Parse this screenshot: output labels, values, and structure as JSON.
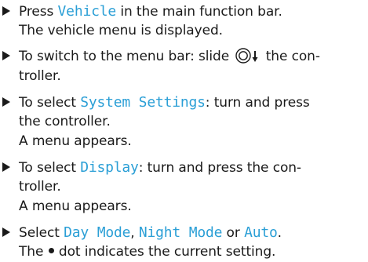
{
  "steps": [
    {
      "lines": [
        {
          "before": "Press ",
          "keyword": "Vehicle",
          "after": " in the main function bar."
        },
        {
          "text": "The vehicle menu is displayed."
        }
      ]
    },
    {
      "lines": [
        {
          "before": "To switch to the menu bar: slide ",
          "icon": "controller-slide-down-icon",
          "after": " the con-"
        },
        {
          "text": "troller."
        }
      ]
    },
    {
      "lines": [
        {
          "before": "To select ",
          "keyword": "System Settings",
          "after": ": turn and press"
        },
        {
          "text": "the controller."
        },
        {
          "text": "A menu appears."
        }
      ]
    },
    {
      "lines": [
        {
          "before": "To select ",
          "keyword": "Display",
          "after": ": turn and press the con-"
        },
        {
          "text": "troller."
        },
        {
          "text": "A menu appears."
        }
      ]
    },
    {
      "lines": [
        {
          "before": "Select ",
          "kw1": "Day Mode",
          "sep1": ", ",
          "kw2": "Night Mode",
          "sep2": " or ",
          "kw3": "Auto",
          "after": "."
        },
        {
          "before": "The ",
          "icon": "bullet-dot-icon",
          "after": " dot indicates the current setting."
        }
      ]
    }
  ],
  "colors": {
    "keyword": "#2b9fd6",
    "text": "#1a1a1a"
  }
}
